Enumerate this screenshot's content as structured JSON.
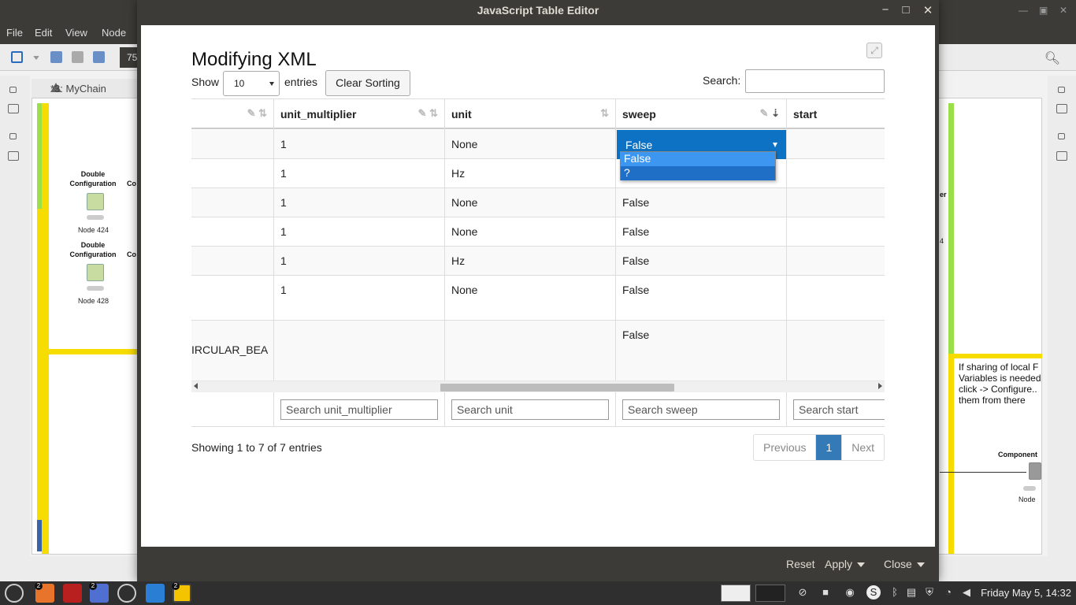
{
  "background": {
    "menu": [
      "File",
      "Edit",
      "View",
      "Node"
    ],
    "toolbar_value": "75",
    "tab_title": "*3: MyChain",
    "nodes": [
      {
        "title": "Double\nConfiguration",
        "label": "Node 424"
      },
      {
        "title": "Double\nConfiguration",
        "label": "Node 428"
      }
    ],
    "partial_left": "Co",
    "right_note": "If sharing of local F\nVariables is needed\nclick -> Configure..\nthem from there",
    "right_component": "Component",
    "right_node": "Node",
    "right_partial_1": "er",
    "right_partial_2": "4"
  },
  "dialog": {
    "title": "JavaScript Table Editor",
    "controls": {
      "minimize": "−",
      "maximize": "□",
      "close": "✕"
    },
    "page_title": "Modifying XML",
    "show_label": "Show",
    "show_value": "10",
    "entries_label": "entries",
    "clear_sorting": "Clear Sorting",
    "search_label": "Search:",
    "columns": [
      {
        "key": "first",
        "label": ""
      },
      {
        "key": "unit_multiplier",
        "label": "unit_multiplier"
      },
      {
        "key": "unit",
        "label": "unit"
      },
      {
        "key": "sweep",
        "label": "sweep"
      },
      {
        "key": "start",
        "label": "start"
      }
    ],
    "rows": [
      {
        "first": "",
        "unit_multiplier": "1",
        "unit": "None",
        "sweep": "False",
        "start": ""
      },
      {
        "first": "",
        "unit_multiplier": "1",
        "unit": "Hz",
        "sweep": "",
        "start": ""
      },
      {
        "first": "",
        "unit_multiplier": "1",
        "unit": "None",
        "sweep": "False",
        "start": ""
      },
      {
        "first": "",
        "unit_multiplier": "1",
        "unit": "None",
        "sweep": "False",
        "start": ""
      },
      {
        "first": "",
        "unit_multiplier": "1",
        "unit": "Hz",
        "sweep": "False",
        "start": ""
      },
      {
        "first": "",
        "unit_multiplier": "1",
        "unit": "None",
        "sweep": "False",
        "start": ""
      },
      {
        "first": "IRCULAR_BEA",
        "unit_multiplier": "",
        "unit": "",
        "sweep": "False",
        "start": ""
      }
    ],
    "editing_cell": {
      "value": "False",
      "options": [
        "False",
        "?"
      ]
    },
    "column_search_placeholders": [
      "Search unit_multiplier",
      "Search unit",
      "Search sweep",
      "Search start"
    ],
    "info": "Showing 1 to 7 of 7 entries",
    "pager": {
      "previous": "Previous",
      "page": "1",
      "next": "Next"
    },
    "footer": {
      "reset": "Reset",
      "apply": "Apply",
      "close": "Close"
    }
  },
  "taskbar": {
    "clock": "Friday May  5, 14:32",
    "badges": [
      "2",
      "2",
      "2"
    ]
  }
}
